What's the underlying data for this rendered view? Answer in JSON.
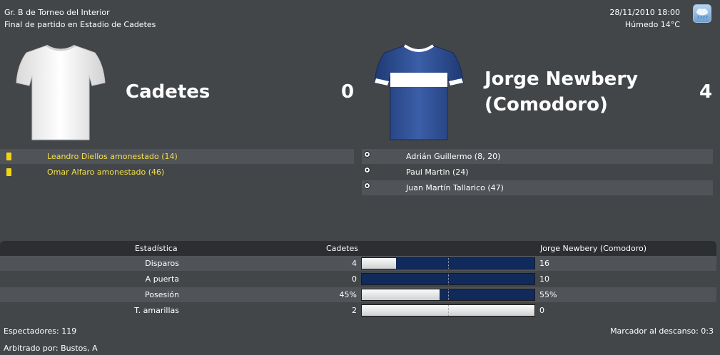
{
  "header": {
    "competition": "Gr. B de Torneo del Interior",
    "status": "Final de partido en Estadio de Cadetes",
    "datetime": "28/11/2010 18:00",
    "weather": "Húmedo 14°C",
    "weather_icon": "rain-cloud-icon"
  },
  "home": {
    "name": "Cadetes",
    "score": "0",
    "shirt_color": "#f2f2f2",
    "events": [
      {
        "icon": "yellow-card-icon",
        "text": "Leandro Diellos amonestado (14)"
      },
      {
        "icon": "yellow-card-icon",
        "text": "Omar Alfaro amonestado (46)"
      }
    ]
  },
  "away": {
    "name_line1": "Jorge Newbery",
    "name_line2": "(Comodoro)",
    "score": "4",
    "shirt_color": "#2b4a8c",
    "events": [
      {
        "icon": "ball-icon",
        "text": "Adrián Guillermo (8, 20)"
      },
      {
        "icon": "ball-icon",
        "text": "Paul Martin (24)"
      },
      {
        "icon": "ball-icon",
        "text": "Juan Martín Tallarico (47)"
      }
    ]
  },
  "stats": {
    "header_label": "Estadística",
    "home_label": "Cadetes",
    "away_label": "Jorge Newbery (Comodoro)",
    "rows": [
      {
        "label": "Disparos",
        "home": "4",
        "away": "16",
        "home_share": 0.2
      },
      {
        "label": "A puerta",
        "home": "0",
        "away": "10",
        "home_share": 0.0
      },
      {
        "label": "Posesión",
        "home": "45%",
        "away": "55%",
        "home_share": 0.45
      },
      {
        "label": "T. amarillas",
        "home": "2",
        "away": "0",
        "home_share": 1.0
      }
    ],
    "colors": {
      "home": "#e8e8e8",
      "away": "#102a5c"
    }
  },
  "footer": {
    "spectators": "Espectadores: 119",
    "halftime": "Marcador al descanso: 0:3",
    "referee": "Arbitrado por: Bustos, A"
  }
}
